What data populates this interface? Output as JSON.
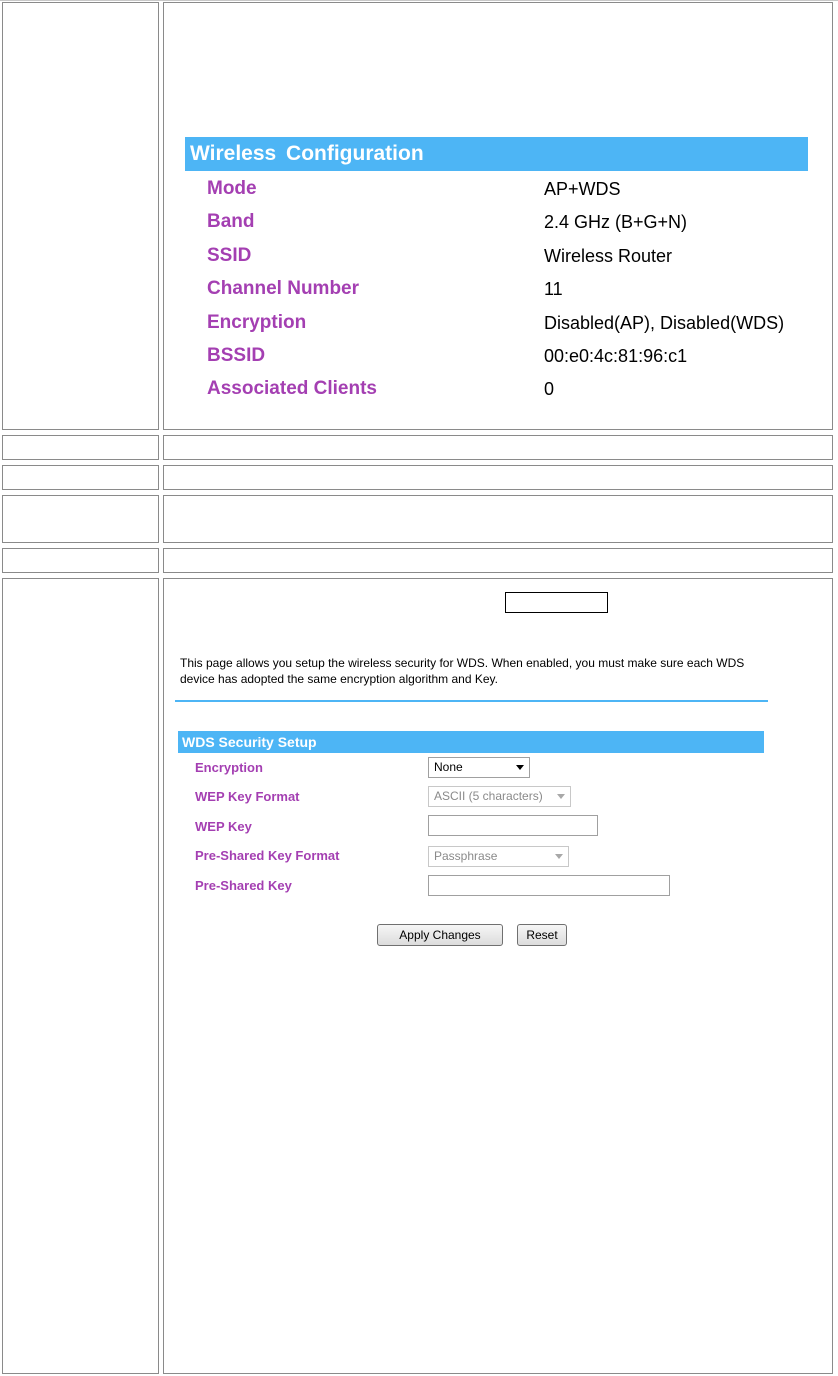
{
  "wireless_config": {
    "title": "Wireless  Configuration",
    "rows": [
      {
        "label": "Mode",
        "value": "AP+WDS"
      },
      {
        "label": "Band",
        "value": "2.4 GHz (B+G+N)"
      },
      {
        "label": "SSID",
        "value": "Wireless Router"
      },
      {
        "label": "Channel Number",
        "value": "11"
      },
      {
        "label": "Encryption",
        "value": "Disabled(AP), Disabled(WDS)"
      },
      {
        "label": "BSSID",
        "value": "00:e0:4c:81:96:c1"
      },
      {
        "label": "Associated Clients",
        "value": "0"
      }
    ]
  },
  "wds_security": {
    "description": "This page allows you setup the wireless security for WDS. When enabled, you must make sure each WDS device has adopted the same encryption algorithm and Key.",
    "title": "WDS Security Setup",
    "encryption": {
      "label": "Encryption",
      "value": "None"
    },
    "wep_key_format": {
      "label": "WEP Key Format",
      "value": "ASCII (5 characters)"
    },
    "wep_key": {
      "label": "WEP Key",
      "value": ""
    },
    "psk_format": {
      "label": "Pre-Shared Key Format",
      "value": "Passphrase"
    },
    "psk": {
      "label": "Pre-Shared Key",
      "value": ""
    },
    "apply_label": "Apply Changes",
    "reset_label": "Reset"
  },
  "colors": {
    "accent": "#4db5f5",
    "label": "#a43fb2"
  }
}
